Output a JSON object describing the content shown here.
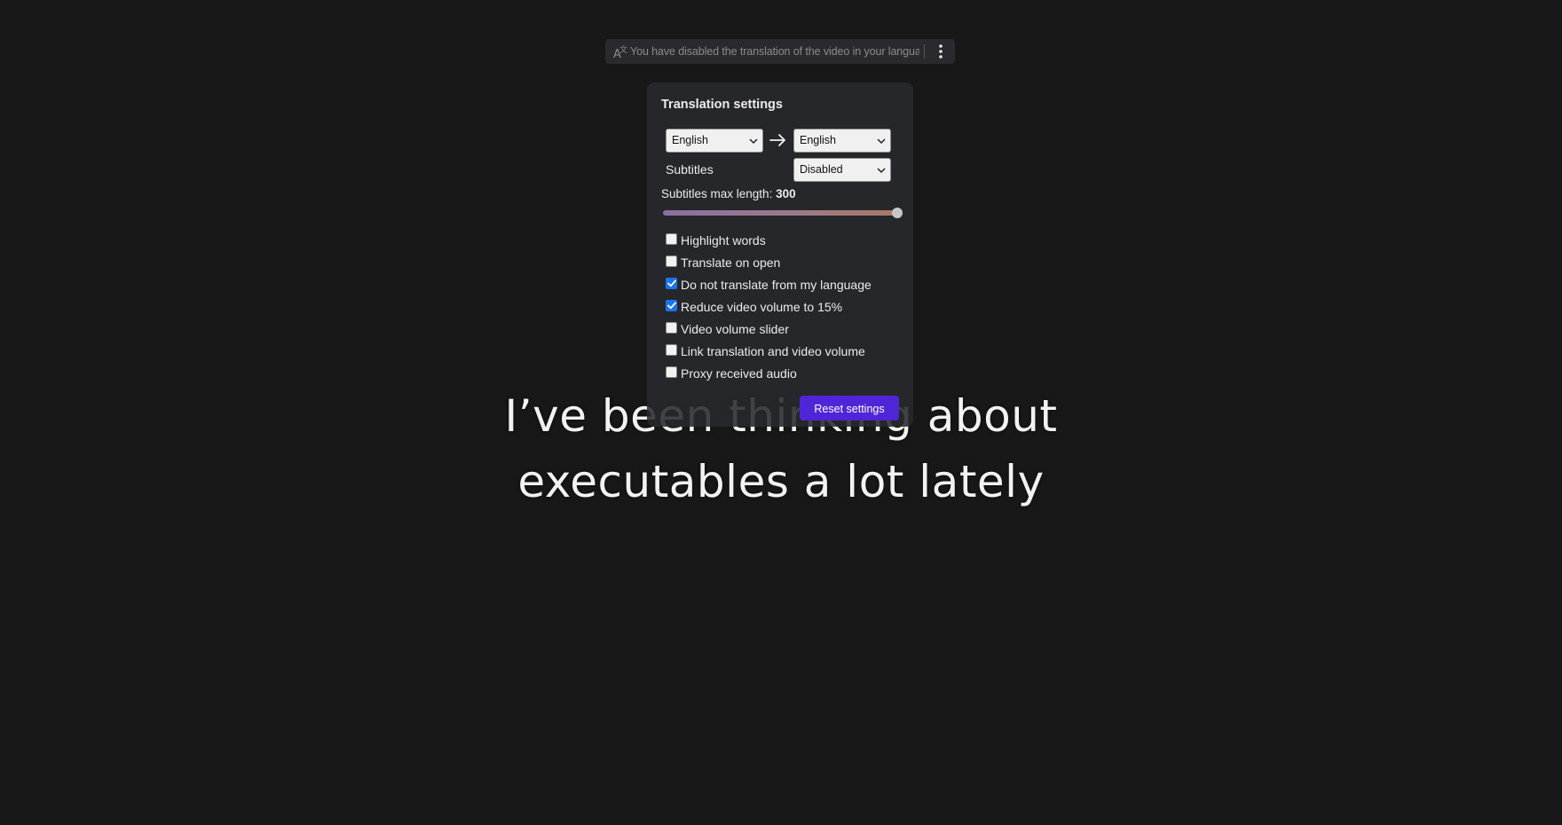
{
  "topbar": {
    "message": "You have disabled the translation of the video in your language",
    "translate_icon": "translate-icon",
    "menu_icon": "vertical-dots-icon"
  },
  "subtitles_overlay": {
    "line1": "I’ve been thinking about",
    "line2": "executables a lot lately"
  },
  "panel": {
    "title": "Translation settings",
    "from_language": "English",
    "to_language": "English",
    "arrow_icon": "arrow-right-icon",
    "subtitles_label": "Subtitles",
    "subtitles_value": "Disabled",
    "max_length_label": "Subtitles max length:",
    "max_length_value": "300",
    "max_length_slider_fraction": 1.0,
    "checkboxes": [
      {
        "label": "Highlight words",
        "checked": false
      },
      {
        "label": "Translate on open",
        "checked": false
      },
      {
        "label": "Do not translate from my language",
        "checked": true
      },
      {
        "label": "Reduce video volume to 15%",
        "checked": true
      },
      {
        "label": "Video volume slider",
        "checked": false
      },
      {
        "label": "Link translation and video volume",
        "checked": false
      },
      {
        "label": "Proxy received audio",
        "checked": false
      }
    ],
    "reset_button": "Reset settings"
  },
  "colors": {
    "background": "#181818",
    "panel": "#28292e",
    "accent_button": "#4f25d8",
    "checkbox_checked": "#1a73e8"
  }
}
